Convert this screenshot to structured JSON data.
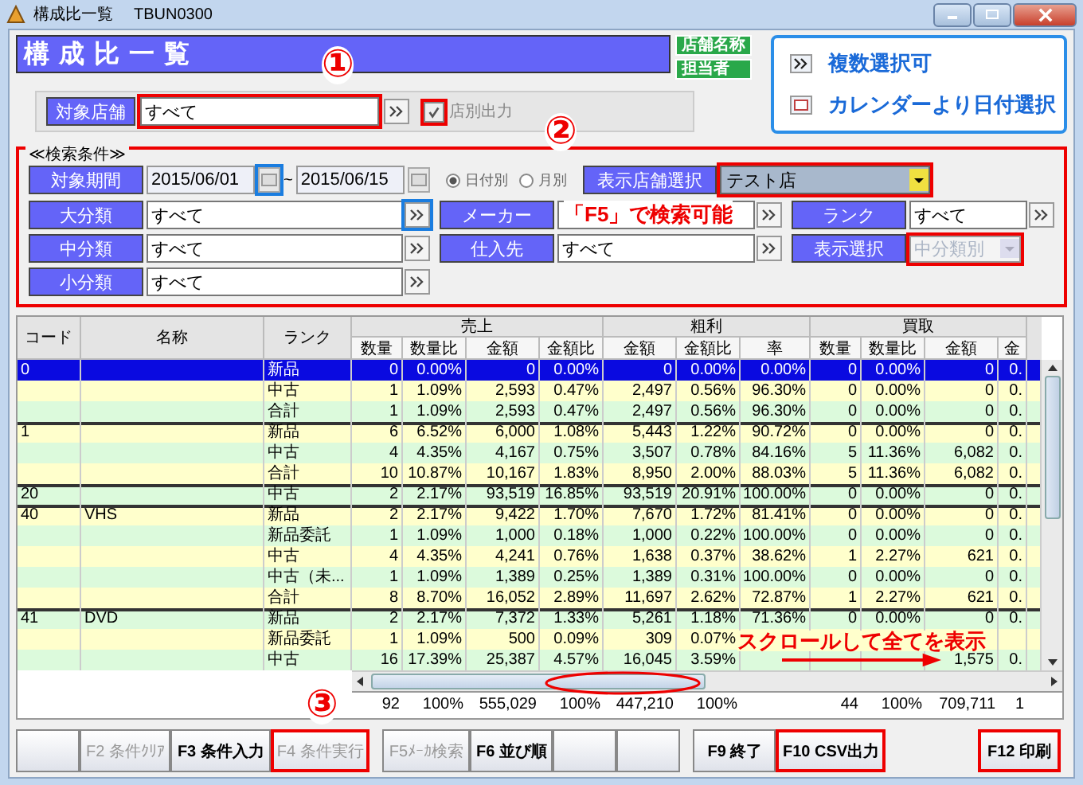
{
  "window": {
    "title": "構成比一覧",
    "code": "TBUN0300"
  },
  "header": {
    "title": "構成比一覧",
    "labels": [
      "店舗名称",
      "担当者"
    ]
  },
  "legend": [
    {
      "kind": "lookup",
      "text": "複数選択可"
    },
    {
      "kind": "calendar",
      "text": "カレンダーより日付選択"
    }
  ],
  "store_row": {
    "label": "対象店舗",
    "value": "すべて",
    "red_box": true,
    "checkbox": {
      "label": "店別出力",
      "checked": true,
      "disabled": true,
      "red_box": true
    }
  },
  "search": {
    "title": "≪検索条件≫",
    "red_box": true,
    "period": {
      "label": "対象期間",
      "from": "2015/06/01",
      "to": "2015/06/15",
      "separator": "~",
      "calendar_blue_box": true
    },
    "radios": [
      {
        "label": "日付別",
        "selected": true
      },
      {
        "label": "月別",
        "selected": false
      }
    ],
    "store_select": {
      "label": "表示店舗選択",
      "value": "テスト店",
      "red_box": true
    },
    "fields": [
      {
        "label": "大分類",
        "value": "すべて",
        "kind": "lookup",
        "disabled": false,
        "blue_box": true
      },
      {
        "label": "メーカー",
        "kind": "lookup",
        "disabled": false,
        "note": "「F5」で検索可能"
      },
      {
        "label": "ランク",
        "value": "すべて",
        "kind": "lookup",
        "disabled": false
      },
      {
        "label": "中分類",
        "value": "すべて",
        "kind": "lookup",
        "disabled": false
      },
      {
        "label": "仕入先",
        "value": "すべて",
        "kind": "lookup",
        "disabled": false
      },
      {
        "label": "表示選択",
        "value": "中分類別",
        "kind": "select",
        "disabled": true,
        "red_box": true
      },
      {
        "label": "小分類",
        "value": "すべて",
        "kind": "lookup",
        "disabled": false
      }
    ]
  },
  "table": {
    "fixed_columns": [
      "コード",
      "名称",
      "ランク"
    ],
    "column_groups": [
      {
        "label": "売上",
        "columns": [
          "数量",
          "数量比",
          "金額",
          "金額比"
        ]
      },
      {
        "label": "粗利",
        "columns": [
          "金額",
          "金額比",
          "率"
        ]
      },
      {
        "label": "買取",
        "columns": [
          "数量",
          "数量比",
          "金額",
          "金"
        ]
      }
    ],
    "rows": [
      {
        "selected": true,
        "separator": false,
        "cells": [
          "0",
          null,
          "新品",
          "0",
          "0.00%",
          "0",
          "0.00%",
          "0",
          "0.00%",
          "0.00%",
          "0",
          "0.00%",
          "0",
          "0."
        ]
      },
      {
        "selected": false,
        "separator": false,
        "cells": [
          null,
          null,
          "中古",
          "1",
          "1.09%",
          "2,593",
          "0.47%",
          "2,497",
          "0.56%",
          "96.30%",
          "0",
          "0.00%",
          "0",
          "0."
        ]
      },
      {
        "selected": false,
        "separator": false,
        "cells": [
          null,
          null,
          "合計",
          "1",
          "1.09%",
          "2,593",
          "0.47%",
          "2,497",
          "0.56%",
          "96.30%",
          "0",
          "0.00%",
          "0",
          "0."
        ]
      },
      {
        "selected": false,
        "separator": true,
        "cells": [
          "1",
          null,
          "新品",
          "6",
          "6.52%",
          "6,000",
          "1.08%",
          "5,443",
          "1.22%",
          "90.72%",
          "0",
          "0.00%",
          "0",
          "0."
        ]
      },
      {
        "selected": false,
        "separator": false,
        "cells": [
          null,
          null,
          "中古",
          "4",
          "4.35%",
          "4,167",
          "0.75%",
          "3,507",
          "0.78%",
          "84.16%",
          "5",
          "11.36%",
          "6,082",
          "0."
        ]
      },
      {
        "selected": false,
        "separator": false,
        "cells": [
          null,
          null,
          "合計",
          "10",
          "10.87%",
          "10,167",
          "1.83%",
          "8,950",
          "2.00%",
          "88.03%",
          "5",
          "11.36%",
          "6,082",
          "0."
        ]
      },
      {
        "selected": false,
        "separator": true,
        "cells": [
          "20",
          null,
          "中古",
          "2",
          "2.17%",
          "93,519",
          "16.85%",
          "93,519",
          "20.91%",
          "100.00%",
          "0",
          "0.00%",
          "0",
          "0."
        ]
      },
      {
        "selected": false,
        "separator": true,
        "cells": [
          "40",
          "VHS",
          "新品",
          "2",
          "2.17%",
          "9,422",
          "1.70%",
          "7,670",
          "1.72%",
          "81.41%",
          "0",
          "0.00%",
          "0",
          "0."
        ]
      },
      {
        "selected": false,
        "separator": false,
        "cells": [
          null,
          null,
          "新品委託",
          "1",
          "1.09%",
          "1,000",
          "0.18%",
          "1,000",
          "0.22%",
          "100.00%",
          "0",
          "0.00%",
          "0",
          "0."
        ]
      },
      {
        "selected": false,
        "separator": false,
        "cells": [
          null,
          null,
          "中古",
          "4",
          "4.35%",
          "4,241",
          "0.76%",
          "1,638",
          "0.37%",
          "38.62%",
          "1",
          "2.27%",
          "621",
          "0."
        ]
      },
      {
        "selected": false,
        "separator": false,
        "cells": [
          null,
          null,
          "中古（未...",
          "1",
          "1.09%",
          "1,389",
          "0.25%",
          "1,389",
          "0.31%",
          "100.00%",
          "0",
          "0.00%",
          "0",
          "0."
        ]
      },
      {
        "selected": false,
        "separator": false,
        "cells": [
          null,
          null,
          "合計",
          "8",
          "8.70%",
          "16,052",
          "2.89%",
          "11,697",
          "2.62%",
          "72.87%",
          "1",
          "2.27%",
          "621",
          "0."
        ]
      },
      {
        "selected": false,
        "separator": true,
        "cells": [
          "41",
          "DVD",
          "新品",
          "2",
          "2.17%",
          "7,372",
          "1.33%",
          "5,261",
          "1.18%",
          "71.36%",
          "0",
          "0.00%",
          "0",
          "0."
        ]
      },
      {
        "selected": false,
        "separator": false,
        "cells": [
          null,
          null,
          "新品委託",
          "1",
          "1.09%",
          "500",
          "0.09%",
          "309",
          "0.07%",
          null,
          null,
          null,
          null,
          null
        ]
      },
      {
        "selected": false,
        "separator": false,
        "cells": [
          null,
          null,
          "中古",
          "16",
          "17.39%",
          "25,387",
          "4.57%",
          "16,045",
          "3.59%",
          null,
          null,
          null,
          "1,575",
          "0."
        ]
      }
    ],
    "totals": {
      "sales": [
        "92",
        "100%",
        "555,029",
        "100%"
      ],
      "profit": [
        "447,210",
        "100%"
      ],
      "purchase": [
        "44",
        "100%",
        "709,711",
        "1"
      ]
    }
  },
  "scroll_note": "スクロールして全てを表示",
  "markers": [
    "①",
    "②",
    "③"
  ],
  "footer": [
    [
      {
        "kind": "blank"
      },
      {
        "kind": "key",
        "label": "F2 条件ｸﾘｱ",
        "disabled": true,
        "red_box": false
      },
      {
        "kind": "key",
        "label": "F3 条件入力",
        "disabled": false,
        "red_box": false
      },
      {
        "kind": "key",
        "label": "F4 条件実行",
        "disabled": true,
        "red_box": true
      }
    ],
    [
      {
        "kind": "key",
        "label": "F5ﾒｰｶ検索",
        "disabled": true,
        "red_box": false
      },
      {
        "kind": "key",
        "label": "F6 並び順",
        "disabled": false,
        "red_box": false
      },
      {
        "kind": "blank"
      },
      {
        "kind": "blank"
      }
    ],
    [
      {
        "kind": "key",
        "label": "F9 終了",
        "disabled": false,
        "red_box": false
      },
      {
        "kind": "key",
        "label": "F10 CSV出力",
        "disabled": false,
        "red_box": true
      }
    ],
    [
      {
        "kind": "key",
        "label": "F12 印刷",
        "disabled": false,
        "red_box": true
      }
    ]
  ]
}
